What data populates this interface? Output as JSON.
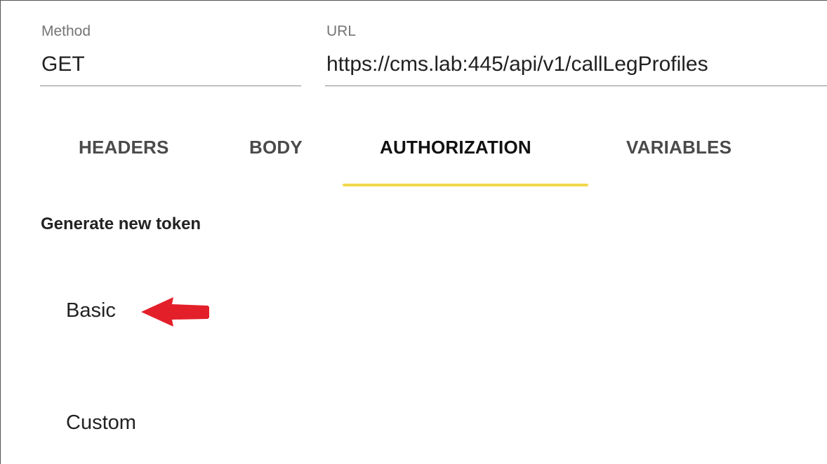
{
  "request": {
    "method_label": "Method",
    "method_value": "GET",
    "url_label": "URL",
    "url_value": "https://cms.lab:445/api/v1/callLegProfiles"
  },
  "tabs": [
    {
      "label": "HEADERS",
      "active": false
    },
    {
      "label": "BODY",
      "active": false
    },
    {
      "label": "AUTHORIZATION",
      "active": true
    },
    {
      "label": "VARIABLES",
      "active": false
    }
  ],
  "authorization": {
    "section_title": "Generate new token",
    "options": [
      {
        "label": "Basic",
        "highlighted": true
      },
      {
        "label": "Custom",
        "highlighted": false
      }
    ]
  },
  "colors": {
    "tab_indicator": "#f2d64b",
    "annotation_arrow": "#e3202a"
  },
  "icons": {
    "annotation": "red-arrow-left-icon"
  }
}
